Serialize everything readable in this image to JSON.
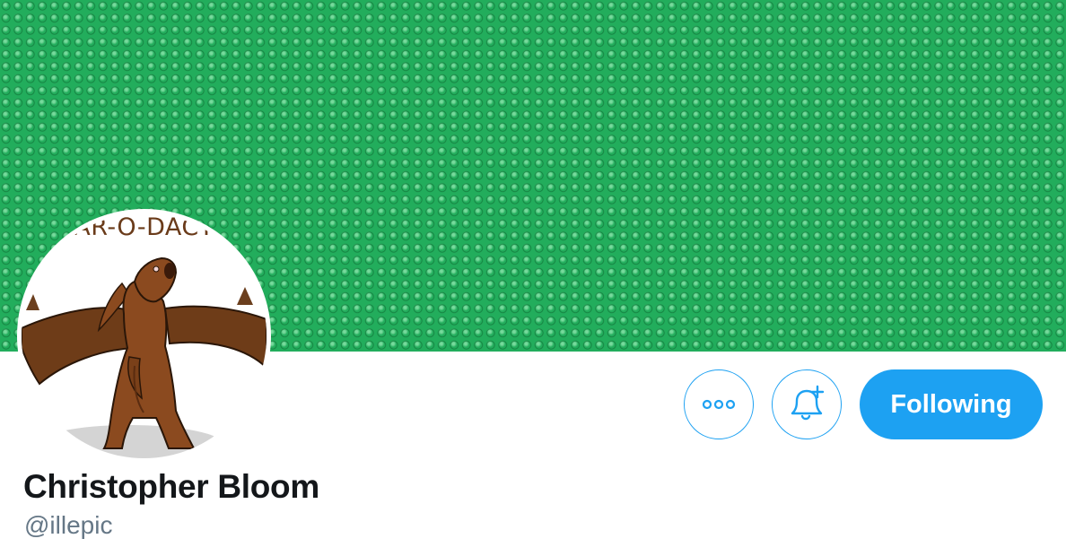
{
  "banner": {
    "pattern": "green studded baseplate",
    "color": "#22ad5c"
  },
  "avatar": {
    "text": "AR-O-DACT"
  },
  "actions": {
    "more_icon": "more-horizontal-icon",
    "notify_icon": "bell-plus-icon",
    "follow_label": "Following",
    "accent": "#1da1f2"
  },
  "profile": {
    "name": "Christopher Bloom",
    "handle": "@illepic"
  }
}
